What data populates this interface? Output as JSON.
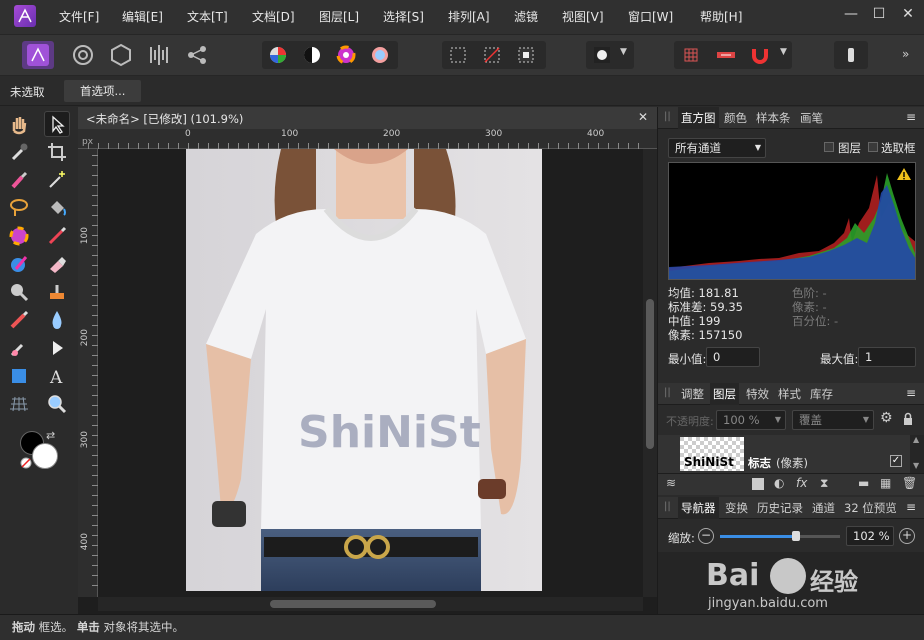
{
  "app": {
    "name": "Affinity Photo"
  },
  "menu": [
    {
      "id": "file",
      "label": "文件[F]"
    },
    {
      "id": "edit",
      "label": "编辑[E]"
    },
    {
      "id": "text",
      "label": "文本[T]"
    },
    {
      "id": "document",
      "label": "文档[D]"
    },
    {
      "id": "layer",
      "label": "图层[L]"
    },
    {
      "id": "select",
      "label": "选择[S]"
    },
    {
      "id": "arrange",
      "label": "排列[A]"
    },
    {
      "id": "filters",
      "label": "滤镜"
    },
    {
      "id": "view",
      "label": "视图[V]"
    },
    {
      "id": "window",
      "label": "窗口[W]"
    },
    {
      "id": "help",
      "label": "帮助[H]"
    }
  ],
  "window_controls": {
    "minimize": "—",
    "maximize": "☐",
    "close": "✕"
  },
  "context": {
    "selection_state": "未选取",
    "preferences_button": "首选项..."
  },
  "document_tab": {
    "title": "<未命名> [已修改] (101.9%)",
    "close": "✕"
  },
  "ruler": {
    "unit": "px",
    "h_ticks": [
      "0",
      "100",
      "200",
      "300",
      "400"
    ],
    "v_ticks": [
      "100",
      "200",
      "300",
      "400"
    ]
  },
  "histogram_panel": {
    "tabs": [
      "直方图",
      "颜色",
      "样本条",
      "画笔"
    ],
    "active_tab": "直方图",
    "channel_select": "所有通道",
    "checkbox_layer": "图层",
    "checkbox_selection": "选取框",
    "warning_icon": "warning-icon",
    "stats": {
      "mean": "均值: 181.81",
      "stddev": "标准差: 59.35",
      "median": "中值: 199",
      "pixels": "像素: 157150"
    },
    "stats_right": {
      "level": "色阶: -",
      "pixels": "像素: -",
      "percentile": "百分位: -"
    },
    "min_label": "最小值:",
    "min_value": "0",
    "max_label": "最大值:",
    "max_value": "1"
  },
  "layers_panel": {
    "tabs": [
      "调整",
      "图层",
      "特效",
      "样式",
      "库存"
    ],
    "active_tab": "图层",
    "opacity_label": "不透明度:",
    "opacity_value": "100 %",
    "blend_mode": "覆盖",
    "layer_name": "标志",
    "layer_type": "(像素)"
  },
  "navigator_panel": {
    "tabs": [
      "导航器",
      "变换",
      "历史记录",
      "通道",
      "32 位预览"
    ],
    "active_tab": "导航器",
    "zoom_label": "缩放:",
    "zoom_value": "102 %"
  },
  "canvas": {
    "shirt_print": "ShiNiSt"
  },
  "watermark": {
    "text1": "Bai",
    "text2": "经验",
    "url": "jingyan.baidu.com"
  },
  "status": {
    "hint_bold1": "拖动",
    "hint1": "框选。",
    "hint_bold2": "单击",
    "hint2": "对象将其选中。"
  },
  "colors": {
    "accent": "#3a8ee6",
    "ui_bg": "#2b2b2b",
    "app_purple": "#8e3fc7"
  }
}
